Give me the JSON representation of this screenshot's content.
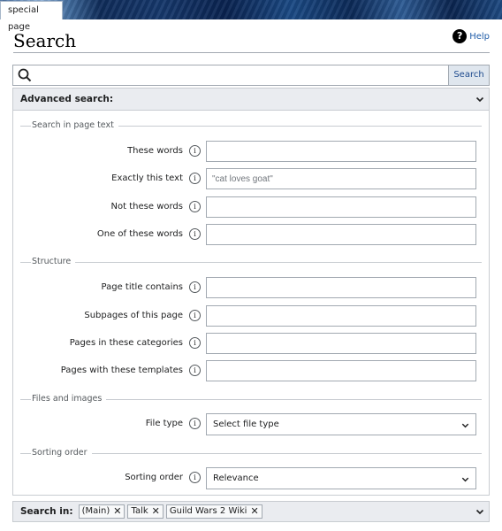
{
  "header": {
    "tab_label": "special page",
    "title": "Search",
    "help_label": "Help"
  },
  "search": {
    "value": "",
    "button_label": "Search"
  },
  "advanced": {
    "heading": "Advanced search:"
  },
  "sections": {
    "page_text": {
      "legend": "Search in page text",
      "fields": [
        {
          "label": "These words",
          "value": "",
          "placeholder": ""
        },
        {
          "label": "Exactly this text",
          "value": "",
          "placeholder": "\"cat loves goat\""
        },
        {
          "label": "Not these words",
          "value": "",
          "placeholder": ""
        },
        {
          "label": "One of these words",
          "value": "",
          "placeholder": ""
        }
      ]
    },
    "structure": {
      "legend": "Structure",
      "fields": [
        {
          "label": "Page title contains",
          "value": ""
        },
        {
          "label": "Subpages of this page",
          "value": ""
        },
        {
          "label": "Pages in these categories",
          "value": ""
        },
        {
          "label": "Pages with these templates",
          "value": ""
        }
      ]
    },
    "files": {
      "legend": "Files and images",
      "label": "File type",
      "selected": "Select file type"
    },
    "sorting": {
      "legend": "Sorting order",
      "label": "Sorting order",
      "selected": "Relevance"
    }
  },
  "search_in": {
    "label": "Search in:",
    "chips": [
      "(Main)",
      "Talk",
      "Guild Wars 2 Wiki"
    ]
  },
  "icons": {
    "help": "help-icon",
    "search": "search-icon",
    "info": "info-icon",
    "remove": "close-icon",
    "expand": "chevron-down-icon"
  }
}
